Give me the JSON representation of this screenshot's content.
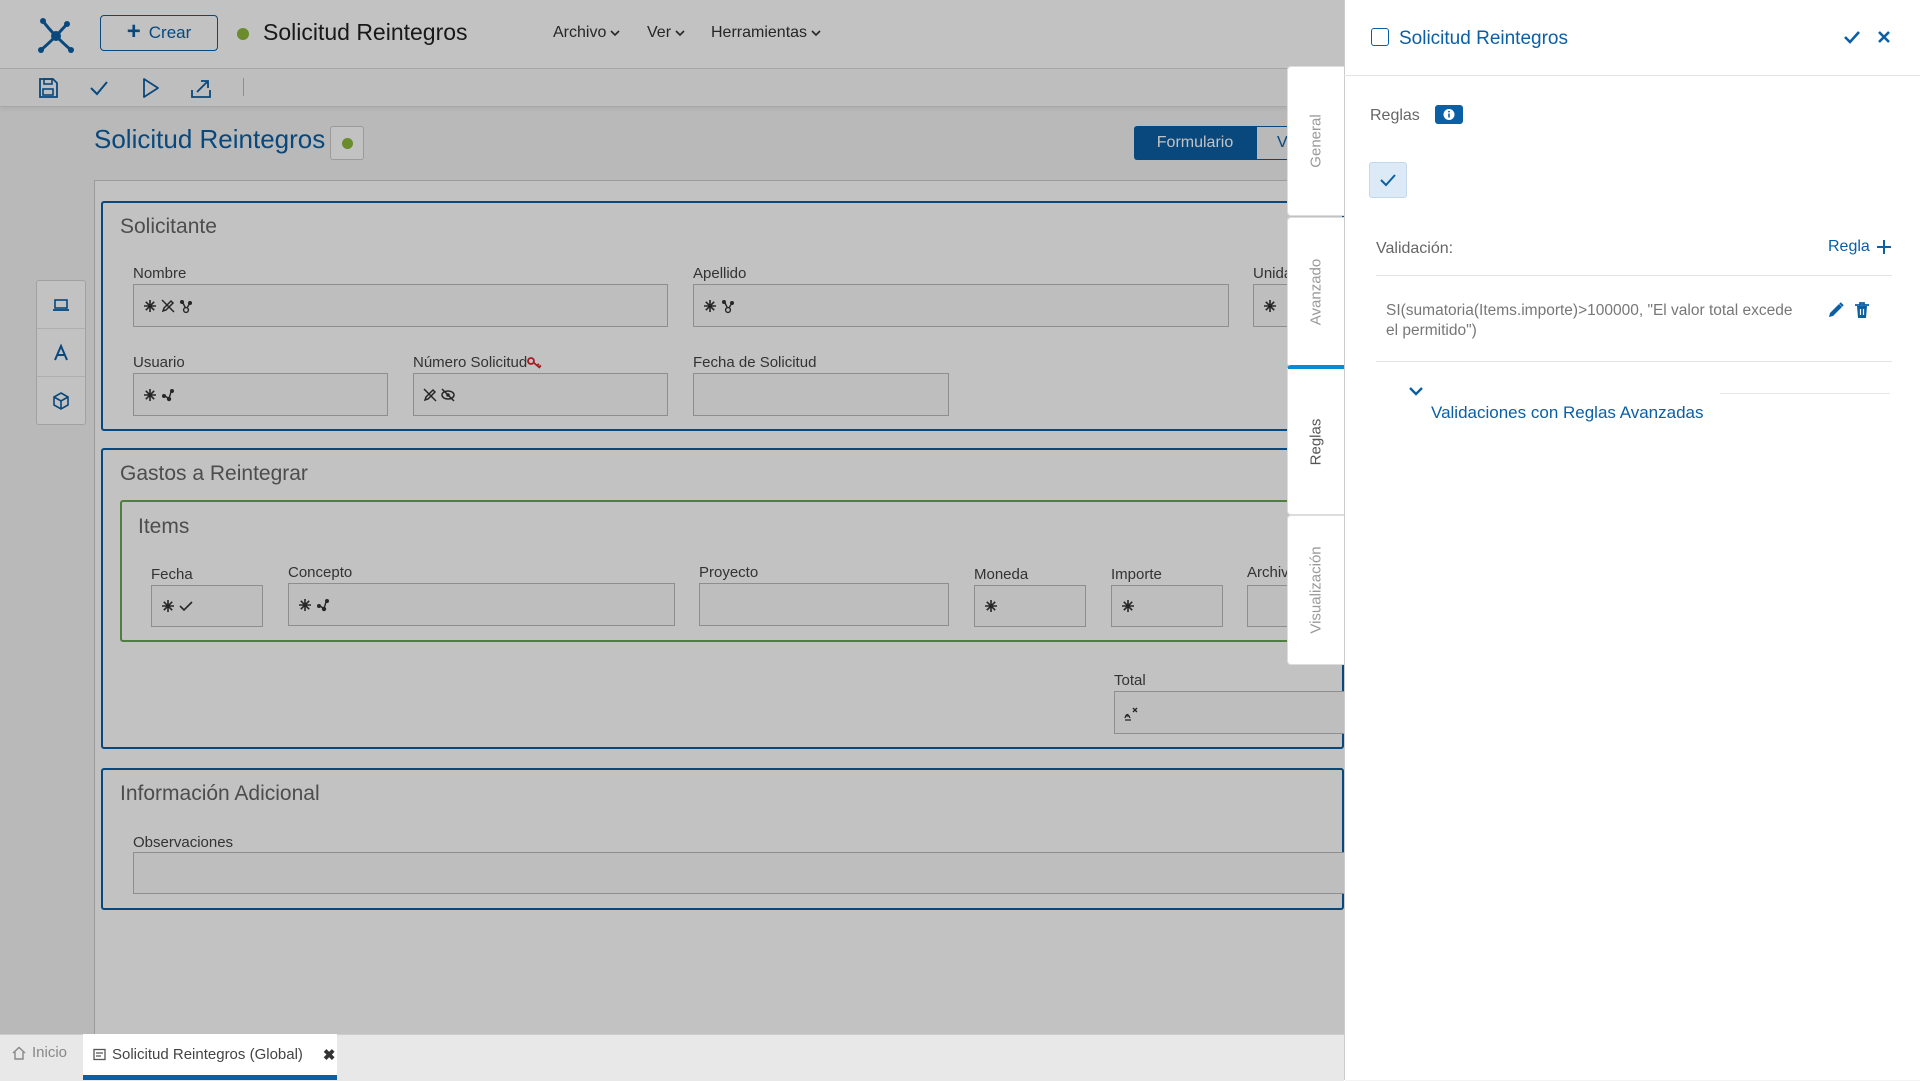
{
  "header": {
    "create_label": "Crear",
    "app_title": "Solicitud Reintegros",
    "menus": [
      "Archivo",
      "Ver",
      "Herramientas"
    ]
  },
  "page": {
    "title": "Solicitud Reintegros",
    "view_tabs": [
      "Formulario",
      "V"
    ]
  },
  "form": {
    "sections": {
      "solicitante": {
        "title": "Solicitante",
        "labels": {
          "nombre": "Nombre",
          "apellido": "Apellido",
          "unidad": "Unida",
          "usuario": "Usuario",
          "numero": "Número Solicitud",
          "fecha": "Fecha de Solicitud"
        }
      },
      "gastos": {
        "title": "Gastos a Reintegrar",
        "grid_title": "Items",
        "columns": [
          "Fecha",
          "Concepto",
          "Proyecto",
          "Moneda",
          "Importe",
          "Archiv"
        ],
        "total_label": "Total"
      },
      "adicional": {
        "title": "Información Adicional",
        "obs_label": "Observaciones"
      }
    }
  },
  "bottom_tabs": {
    "home": "Inicio",
    "doc": "Solicitud Reintegros (Global)"
  },
  "vertical_tabs": [
    "General",
    "Avanzado",
    "Reglas",
    "Visualización"
  ],
  "active_vertical_tab": "Reglas",
  "panel": {
    "title": "Solicitud Reintegros",
    "rules_label": "Reglas",
    "validation_label": "Validación:",
    "add_rule_label": "Regla",
    "rule_text": "SI(sumatoria(Items.importe)>100000, \"El valor total excede el permitido\")",
    "advanced_label": "Validaciones con Reglas Avanzadas"
  },
  "colors": {
    "accent": "#0b5fa5",
    "status_green": "#8cb83b",
    "grid_border": "#69a84f",
    "required_key_red": "#d9262b"
  },
  "icons": [
    "logo-icon",
    "plus-icon",
    "chevron-down-icon",
    "save-icon",
    "check-icon",
    "play-icon",
    "export-icon",
    "laptop-icon",
    "text-icon",
    "cube-icon",
    "asterisk-icon",
    "edit-off-icon",
    "branch-icon",
    "eye-off-icon",
    "key-icon",
    "formula-icon",
    "home-icon",
    "form-icon",
    "close-icon",
    "info-icon",
    "pencil-icon",
    "trash-icon"
  ]
}
